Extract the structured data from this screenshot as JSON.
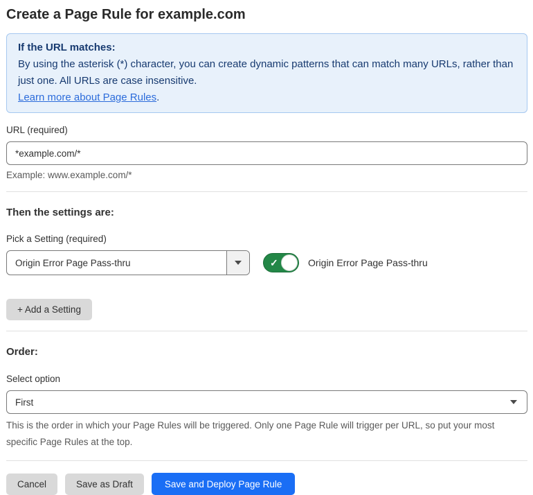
{
  "page": {
    "title": "Create a Page Rule for example.com"
  },
  "info_box": {
    "heading": "If the URL matches:",
    "body": "By using the asterisk (*) character, you can create dynamic patterns that can match many URLs, rather than just one. All URLs are case insensitive.",
    "link_label": "Learn more about Page Rules",
    "link_suffix": "."
  },
  "url_field": {
    "label": "URL (required)",
    "value": "*example.com/*",
    "helper": "Example: www.example.com/*"
  },
  "settings_section": {
    "heading": "Then the settings are:",
    "picker_label": "Pick a Setting (required)",
    "picker_value": "Origin Error Page Pass-thru",
    "toggle": {
      "state": "on",
      "check_glyph": "✓",
      "label": "Origin Error Page Pass-thru"
    },
    "add_setting_label": "+ Add a Setting"
  },
  "order_section": {
    "heading": "Order:",
    "select_label": "Select option",
    "select_value": "First",
    "helper": "This is the order in which your Page Rules will be triggered. Only one Page Rule will trigger per URL, so put your most specific Page Rules at the top."
  },
  "footer": {
    "cancel_label": "Cancel",
    "save_draft_label": "Save as Draft",
    "save_deploy_label": "Save and Deploy Page Rule"
  },
  "colors": {
    "info_bg": "#e8f1fb",
    "info_border": "#a5c8f0",
    "info_text": "#173a70",
    "link_blue": "#2c6cdb",
    "toggle_green": "#238747",
    "toggle_green_border": "#1b6e39",
    "primary_blue": "#1a6ef5",
    "button_gray": "#d9d9d9",
    "text_dark": "#313131",
    "text_muted": "#595959",
    "input_border": "#797979",
    "divider": "#e0e0e0"
  }
}
